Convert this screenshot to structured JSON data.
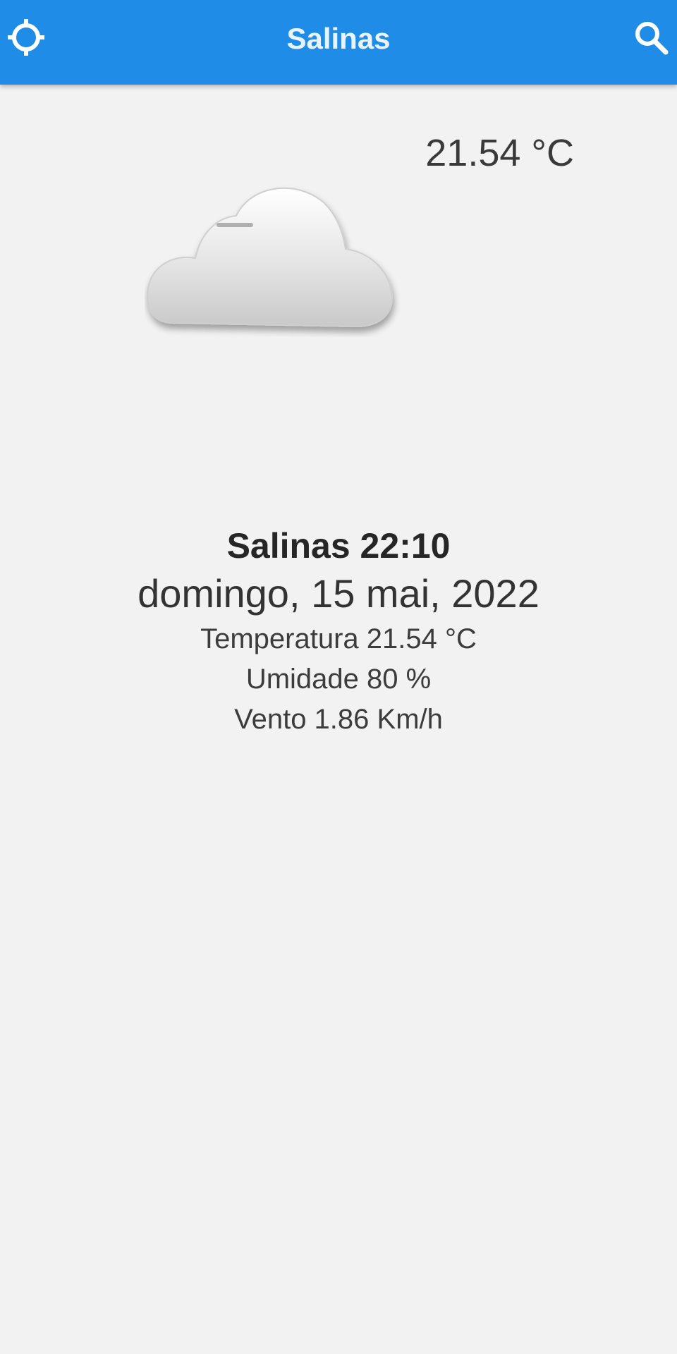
{
  "app_bar": {
    "title": "Salinas",
    "left_icon": "location-target-icon",
    "right_icon": "search-icon",
    "color": "#1f8ce8"
  },
  "current": {
    "temperature_display": "21.54 °C",
    "condition_icon": "cloud-icon"
  },
  "details": {
    "city_time": "Salinas 22:10",
    "date": "domingo, 15 mai, 2022",
    "temperature": "Temperatura 21.54 °C",
    "humidity": "Umidade 80 %",
    "wind": "Vento 1.86 Km/h"
  }
}
